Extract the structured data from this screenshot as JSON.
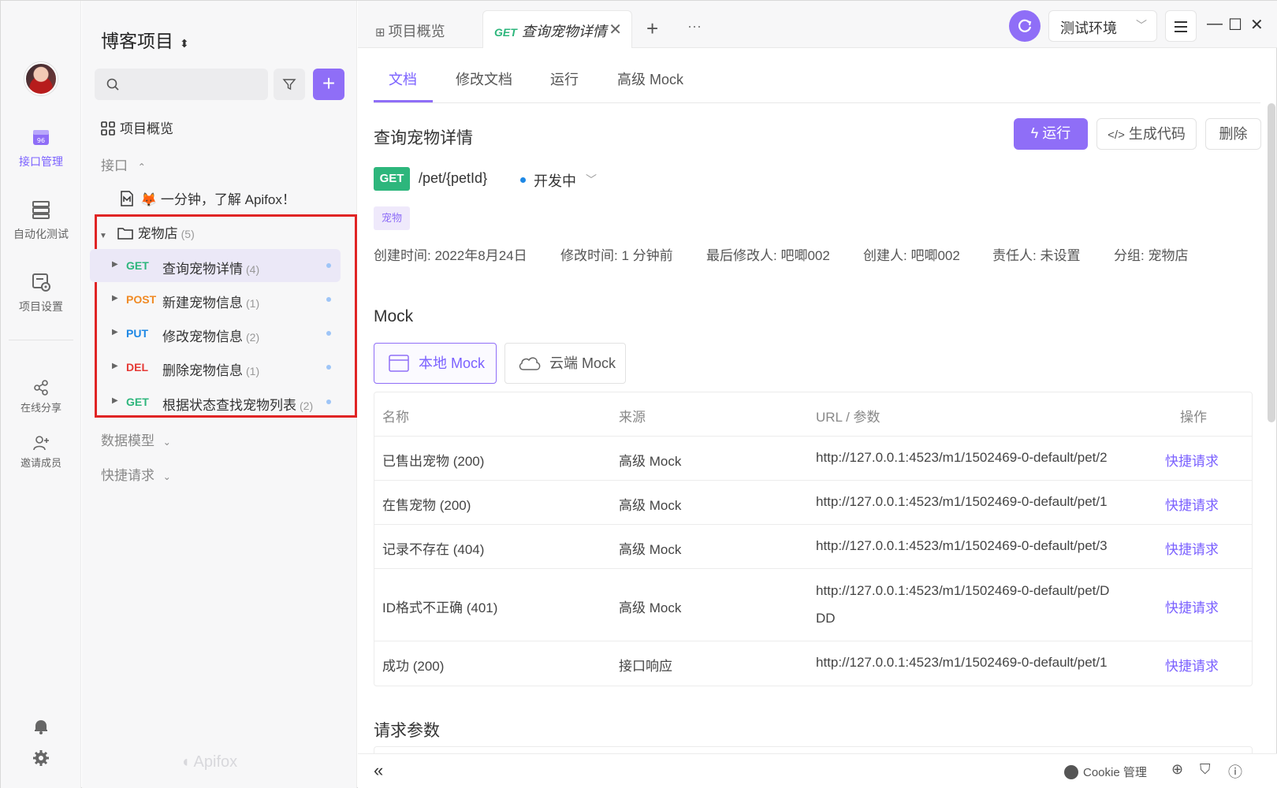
{
  "rail": {
    "items": [
      {
        "label": "接口管理",
        "icon": "api-manage-icon",
        "active": true
      },
      {
        "label": "自动化测试",
        "icon": "automation-icon",
        "active": false
      },
      {
        "label": "项目设置",
        "icon": "project-settings-icon",
        "active": false
      },
      {
        "label": "在线分享",
        "icon": "share-icon",
        "active": false
      },
      {
        "label": "邀请成员",
        "icon": "invite-icon",
        "active": false
      }
    ],
    "bottom_icons": [
      "bell-icon",
      "gear-icon"
    ]
  },
  "sidebar": {
    "project_title": "博客项目",
    "search_placeholder": "",
    "overview_label": "项目概览",
    "api_section_label": "接口",
    "intro_doc": "🦊 一分钟，了解 Apifox！",
    "folder": {
      "name": "宠物店",
      "count": "(5)"
    },
    "apis": [
      {
        "method": "GET",
        "name": "查询宠物详情",
        "count": "(4)",
        "selected": true
      },
      {
        "method": "POST",
        "name": "新建宠物信息",
        "count": "(1)",
        "selected": false
      },
      {
        "method": "PUT",
        "name": "修改宠物信息",
        "count": "(2)",
        "selected": false
      },
      {
        "method": "DEL",
        "name": "删除宠物信息",
        "count": "(1)",
        "selected": false
      },
      {
        "method": "GET",
        "name": "根据状态查找宠物列表",
        "count": "(2)",
        "selected": false
      }
    ],
    "data_model_label": "数据模型",
    "quick_request_label": "快捷请求",
    "watermark": "Apifox"
  },
  "topbar": {
    "tabs": [
      {
        "label": "项目概览",
        "active": false
      },
      {
        "method": "GET",
        "label": "查询宠物详情",
        "active": true
      }
    ],
    "add_tab": "+",
    "more": "···",
    "env_label": "测试环境"
  },
  "subtabs": [
    "文档",
    "修改文档",
    "运行",
    "高级 Mock"
  ],
  "doc": {
    "title": "查询宠物详情",
    "run_label": "运行",
    "gen_code_label": "生成代码",
    "delete_label": "删除",
    "method": "GET",
    "path": "/pet/{petId}",
    "status": "开发中",
    "tag": "宠物",
    "meta": [
      "创建时间: 2022年8月24日",
      "修改时间: 1 分钟前",
      "最后修改人: 吧唧002",
      "创建人: 吧唧002",
      "责任人: 未设置",
      "分组: 宠物店"
    ]
  },
  "mock": {
    "heading": "Mock",
    "local_label": "本地 Mock",
    "cloud_label": "云端 Mock",
    "columns": [
      "名称",
      "来源",
      "URL / 参数",
      "操作"
    ],
    "rows": [
      {
        "name": "已售出宠物 (200)",
        "source": "高级 Mock",
        "url": "http://127.0.0.1:4523/m1/1502469-0-default/pet/2",
        "action": "快捷请求"
      },
      {
        "name": "在售宠物 (200)",
        "source": "高级 Mock",
        "url": "http://127.0.0.1:4523/m1/1502469-0-default/pet/1",
        "action": "快捷请求"
      },
      {
        "name": "记录不存在 (404)",
        "source": "高级 Mock",
        "url": "http://127.0.0.1:4523/m1/1502469-0-default/pet/3",
        "action": "快捷请求"
      },
      {
        "name": "ID格式不正确 (401)",
        "source": "高级 Mock",
        "url_line1": "http://127.0.0.1:4523/m1/1502469-0-default/pet/D",
        "url_line2": "DD",
        "action": "快捷请求"
      },
      {
        "name": "成功 (200)",
        "source": "接口响应",
        "url": "http://127.0.0.1:4523/m1/1502469-0-default/pet/1",
        "action": "快捷请求"
      }
    ]
  },
  "request_params_heading": "请求参数",
  "bottombar": {
    "collapse": "«",
    "cookie_label": "Cookie 管理"
  },
  "colors": {
    "accent": "#8f6ef7",
    "get": "#2db67c",
    "post": "#f08a24",
    "put": "#1e88e5",
    "del": "#e53935",
    "highlight": "#e02424"
  }
}
